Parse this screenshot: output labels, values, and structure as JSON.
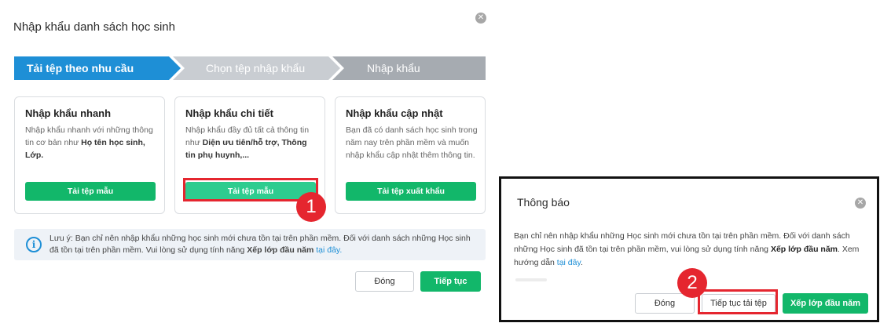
{
  "main_dialog": {
    "title": "Nhập khẩu danh sách học sinh",
    "close_glyph": "✕",
    "steps": [
      {
        "label": "Tải tệp theo nhu cầu"
      },
      {
        "label": "Chọn tệp nhập khẩu"
      },
      {
        "label": "Nhập khẩu"
      }
    ],
    "cards": [
      {
        "title": "Nhập khẩu nhanh",
        "desc_1": "Nhập khẩu nhanh với những thông tin cơ bản như ",
        "desc_bold": "Họ tên học sinh, Lớp.",
        "desc_2": "",
        "button": "Tải tệp mẫu"
      },
      {
        "title": "Nhập khẩu chi tiết",
        "desc_1": "Nhập khẩu đầy đủ tất cả thông tin như ",
        "desc_bold": "Diện ưu tiên/hỗ trợ, Thông tin phụ huynh,...",
        "desc_2": "",
        "button": "Tải tệp mẫu"
      },
      {
        "title": "Nhập khẩu cập nhật",
        "desc_1": "Bạn đã có danh sách học sinh trong năm nay trên phần mềm và muốn nhập khẩu cập nhật thêm thông tin.",
        "desc_bold": "",
        "desc_2": "",
        "button": "Tải tệp xuất khẩu"
      }
    ],
    "note": {
      "icon_glyph": "i",
      "text_1": "Lưu ý: Bạn chỉ nên nhập khẩu những học sinh mới chưa tồn tại trên phần mềm. Đối với danh sách những Học sinh đã tồn tại trên phần mềm. Vui lòng sử dụng tính năng ",
      "bold": "Xếp lớp đầu năm",
      "text_2": " ",
      "link": "tại đây."
    },
    "close_button": "Đóng",
    "continue_button": "Tiếp tục"
  },
  "annotations": {
    "badge_1": "1",
    "badge_2": "2",
    "highlight_color": "#e5262f"
  },
  "notify_dialog": {
    "title": "Thông báo",
    "close_glyph": "✕",
    "text_1": "Bạn chỉ nên nhập khẩu những Học sinh mới chưa tồn tại trên phần mềm. Đối với danh sách những Học sinh đã tồn tại trên phần mềm, vui lòng sử dụng tính năng ",
    "bold": "Xếp lớp đầu năm",
    "text_2": ". Xem hướng dẫn ",
    "link": "tại đây",
    "text_3": ".",
    "close_button": "Đóng",
    "upload_button": "Tiếp tục tải tệp",
    "reorg_button": "Xếp lớp đầu năm"
  },
  "colors": {
    "accent_blue": "#1e8fd6",
    "green": "#12b76a"
  }
}
